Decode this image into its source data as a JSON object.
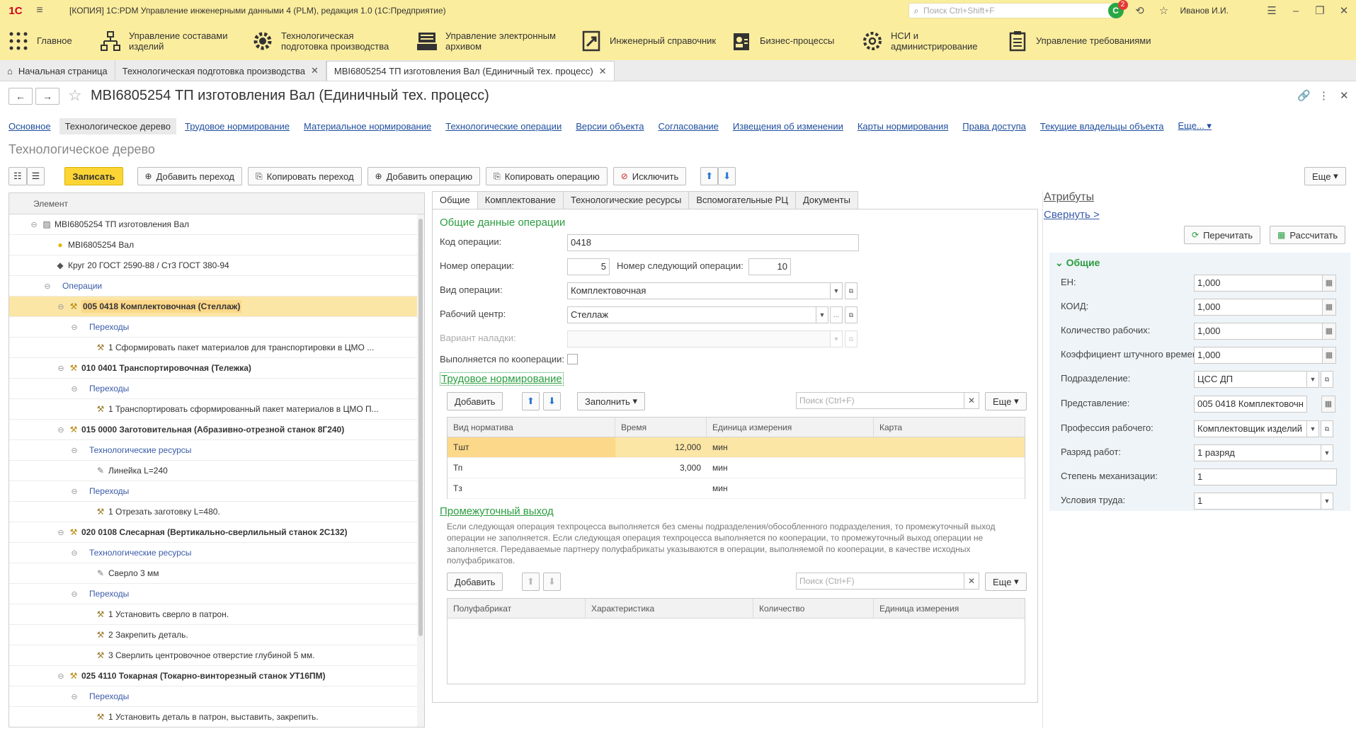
{
  "app": {
    "logo": "1С",
    "title": "[КОПИЯ] 1С:PDM Управление инженерными данными 4 (PLM), редакция 1.0  (1С:Предприятие)",
    "search_placeholder": "Поиск Ctrl+Shift+F",
    "notifications_count": "2",
    "user": "Иванов И.И."
  },
  "sections": [
    {
      "icon": "grid-icon",
      "label": "Главное"
    },
    {
      "icon": "structure-icon",
      "label": "Управление составами изделий"
    },
    {
      "icon": "gear-wrench-icon",
      "label": "Технологическая подготовка производства"
    },
    {
      "icon": "archive-icon",
      "label": "Управление электронным архивом"
    },
    {
      "icon": "handbook-icon",
      "label": "Инженерный справочник"
    },
    {
      "icon": "process-icon",
      "label": "Бизнес-процессы"
    },
    {
      "icon": "settings-icon",
      "label": "НСИ и администрирование"
    },
    {
      "icon": "requirements-icon",
      "label": "Управление требованиями"
    }
  ],
  "open_tabs": [
    {
      "label": "Начальная страница",
      "closable": false
    },
    {
      "label": "Технологическая подготовка производства",
      "closable": true
    },
    {
      "label": "МВI6805254 ТП изготовления Вал (Единичный тех. процесс)",
      "closable": true
    }
  ],
  "form": {
    "title": "МВI6805254 ТП изготовления Вал (Единичный тех. процесс)",
    "subtitle": "Технологическое дерево",
    "nav_links": [
      "Основное",
      "Технологическое дерево",
      "Трудовое нормирование",
      "Материальное нормирование",
      "Технологические операции",
      "Версии объекта",
      "Согласование",
      "Извещения об изменении",
      "Карты нормирования",
      "Права доступа",
      "Текущие владельцы объекта",
      "Еще..."
    ],
    "toolbar": {
      "save": "Записать",
      "add_transition": "Добавить переход",
      "copy_transition": "Копировать переход",
      "add_operation": "Добавить операцию",
      "copy_operation": "Копировать операцию",
      "exclude": "Исключить",
      "more": "Еще"
    }
  },
  "tree": {
    "header": "Элемент",
    "rows": [
      {
        "level": 0,
        "toggle": "⊖",
        "icon": "process-icon",
        "text": "МВI6805254 ТП изготовления Вал",
        "style": ""
      },
      {
        "level": 1,
        "toggle": "",
        "icon": "part-icon",
        "text": "МВI6805254 Вал",
        "style": ""
      },
      {
        "level": 1,
        "toggle": "",
        "icon": "material-icon",
        "text": "Круг 20 ГОСТ 2590-88 / Ст3 ГОСТ 380-94",
        "style": ""
      },
      {
        "level": 1,
        "toggle": "⊖",
        "icon": "",
        "text": "Операции",
        "style": "link"
      },
      {
        "level": 2,
        "toggle": "⊖",
        "icon": "operation-icon",
        "text": "005 0418 Комплектовочная (Стеллаж)",
        "style": "bold",
        "selected": true
      },
      {
        "level": 3,
        "toggle": "⊖",
        "icon": "",
        "text": "Переходы",
        "style": "link"
      },
      {
        "level": 4,
        "toggle": "",
        "icon": "transition-icon",
        "text": "1 Сформировать пакет материалов для транспортировки в ЦМО ...",
        "style": ""
      },
      {
        "level": 2,
        "toggle": "⊖",
        "icon": "operation-icon",
        "text": "010 0401 Транспортировочная (Тележка)",
        "style": "bold"
      },
      {
        "level": 3,
        "toggle": "⊖",
        "icon": "",
        "text": "Переходы",
        "style": "link"
      },
      {
        "level": 4,
        "toggle": "",
        "icon": "transition-icon",
        "text": "1 Транспортировать сформированный пакет материалов в ЦМО П...",
        "style": ""
      },
      {
        "level": 2,
        "toggle": "⊖",
        "icon": "operation-icon",
        "text": "015 0000 Заготовительная (Абразивно-отрезной станок 8Г240)",
        "style": "bold"
      },
      {
        "level": 3,
        "toggle": "⊖",
        "icon": "",
        "text": "Технологические ресурсы",
        "style": "link"
      },
      {
        "level": 4,
        "toggle": "",
        "icon": "tool-icon",
        "text": "Линейка L=240",
        "style": ""
      },
      {
        "level": 3,
        "toggle": "⊖",
        "icon": "",
        "text": "Переходы",
        "style": "link"
      },
      {
        "level": 4,
        "toggle": "",
        "icon": "transition-icon",
        "text": "1 Отрезать заготовку L=480.",
        "style": ""
      },
      {
        "level": 2,
        "toggle": "⊖",
        "icon": "operation-icon",
        "text": "020 0108 Слесарная (Вертикально-сверлильный станок 2С132)",
        "style": "bold"
      },
      {
        "level": 3,
        "toggle": "⊖",
        "icon": "",
        "text": "Технологические ресурсы",
        "style": "link"
      },
      {
        "level": 4,
        "toggle": "",
        "icon": "tool-icon",
        "text": "Сверло 3 мм",
        "style": ""
      },
      {
        "level": 3,
        "toggle": "⊖",
        "icon": "",
        "text": "Переходы",
        "style": "link"
      },
      {
        "level": 4,
        "toggle": "",
        "icon": "transition-icon",
        "text": "1 Установить сверло в патрон.",
        "style": ""
      },
      {
        "level": 4,
        "toggle": "",
        "icon": "transition-icon",
        "text": "2 Закрепить деталь.",
        "style": ""
      },
      {
        "level": 4,
        "toggle": "",
        "icon": "transition-icon",
        "text": "3 Сверлить центровочное отверстие глубиной 5 мм.",
        "style": ""
      },
      {
        "level": 2,
        "toggle": "⊖",
        "icon": "operation-icon",
        "text": "025 4110 Токарная (Токарно-винторезный станок УТ16ПМ)",
        "style": "bold"
      },
      {
        "level": 3,
        "toggle": "⊖",
        "icon": "",
        "text": "Переходы",
        "style": "link"
      },
      {
        "level": 4,
        "toggle": "",
        "icon": "transition-icon",
        "text": "1 Установить деталь в патрон, выставить, закрепить.",
        "style": ""
      }
    ]
  },
  "middle": {
    "tabs": [
      "Общие",
      "Комплектование",
      "Технологические ресурсы",
      "Вспомогательные РЦ",
      "Документы"
    ],
    "general_title": "Общие данные операции",
    "op_code_label": "Код операции:",
    "op_code": "0418",
    "op_number_label": "Номер операции:",
    "op_number": "5",
    "next_op_label": "Номер следующий операции:",
    "next_op": "10",
    "op_type_label": "Вид операции:",
    "op_type": "Комплектовочная",
    "work_center_label": "Рабочий центр:",
    "work_center": "Стеллаж",
    "setup_variant_label": "Вариант наладки:",
    "setup_variant": "",
    "coop_label": "Выполняется по кооперации:",
    "labor_title": "Трудовое нормирование",
    "add": "Добавить",
    "fill": "Заполнить",
    "search_placeholder": "Поиск (Ctrl+F)",
    "more": "Еще",
    "labor_columns": [
      "Вид норматива",
      "Время",
      "Единица измерения",
      "Карта"
    ],
    "labor_rows": [
      {
        "kind": "Тшт",
        "time": "12,000",
        "unit": "мин",
        "card": ""
      },
      {
        "kind": "Тп",
        "time": "3,000",
        "unit": "мин",
        "card": ""
      },
      {
        "kind": "Тз",
        "time": "",
        "unit": "мин",
        "card": ""
      }
    ],
    "interim_title": "Промежуточный выход",
    "interim_note": "Если следующая операция техпроцесса выполняется без смены подразделения/обособленного подразделения, то промежуточный выход операции не заполняется. Если следующая операция техпроцесса выполняется по кооперации, то промежуточный выход операции не заполняется. Передаваемые партнеру полуфабрикаты указываются в операции, выполняемой по кооперации, в качестве исходных полуфабрикатов.",
    "interim_columns": [
      "Полуфабрикат",
      "Характеристика",
      "Количество",
      "Единица измерения"
    ]
  },
  "attributes": {
    "title": "Атрибуты",
    "collapse": "Свернуть >",
    "recalc": "Перечитать",
    "calculate": "Рассчитать",
    "group": "Общие",
    "fields": [
      {
        "label": "ЕН:",
        "value": "1,000",
        "kind": "calc"
      },
      {
        "label": "КОИД:",
        "value": "1,000",
        "kind": "calc"
      },
      {
        "label": "Количество рабочих:",
        "value": "1,000",
        "kind": "calc"
      },
      {
        "label": "Коэффициент штучного времени:",
        "value": "1,000",
        "kind": "calc"
      },
      {
        "label": "Подразделение:",
        "value": "ЦСС ДП",
        "kind": "select-open"
      },
      {
        "label": "Представление:",
        "value": "005 0418 Комплектовочн",
        "kind": "table"
      },
      {
        "label": "Профессия рабочего:",
        "value": "Комплектовщик изделий",
        "kind": "select-open"
      },
      {
        "label": "Разряд работ:",
        "value": "1 разряд",
        "kind": "select"
      },
      {
        "label": "Степень механизации:",
        "value": "1",
        "kind": "plain"
      },
      {
        "label": "Условия труда:",
        "value": "1",
        "kind": "select"
      }
    ]
  },
  "colors": {
    "accent": "#fbed9e",
    "primary_button": "#fcd535",
    "selection": "#fbe6a5",
    "group_title": "#2a9d3f",
    "link": "#1f4e9e"
  }
}
